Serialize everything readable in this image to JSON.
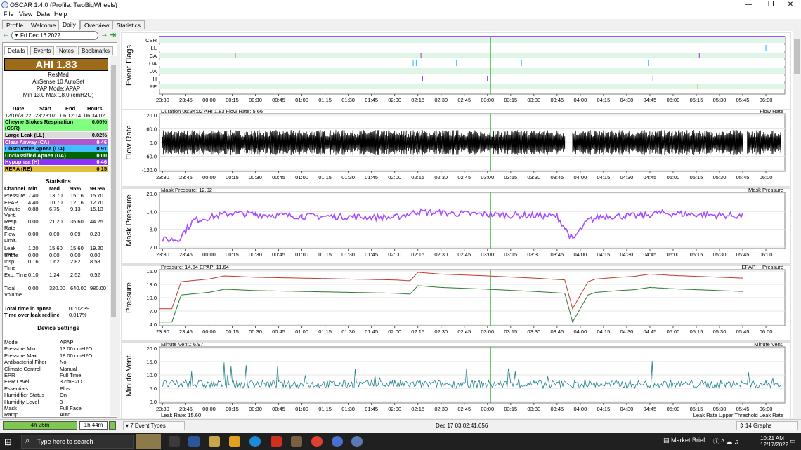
{
  "window": {
    "title": "OSCAR 1.4.0 (Profile: TwoBigWheels)",
    "controls": [
      "—",
      "❐",
      "✕"
    ]
  },
  "menu": [
    "File",
    "View",
    "Data",
    "Help"
  ],
  "tabs": [
    {
      "label": "Profile",
      "active": false
    },
    {
      "label": "Welcome",
      "active": false
    },
    {
      "label": "Daily",
      "active": true
    },
    {
      "label": "Overview",
      "active": false
    },
    {
      "label": "Statistics",
      "active": false
    }
  ],
  "date_nav": {
    "date": "Fri Dec 16 2022"
  },
  "subtabs": [
    {
      "label": "Details",
      "active": true
    },
    {
      "label": "Events",
      "active": false
    },
    {
      "label": "Notes",
      "active": false
    },
    {
      "label": "Bookmarks",
      "active": false
    }
  ],
  "summary": {
    "ahi": "AHI 1.83",
    "maker": "ResMed",
    "model": "AirSense 10 AutoSet",
    "mode": "PAP Mode: APAP",
    "range": "Min 13.0 Max 18.0 (cmH2O)"
  },
  "session": {
    "headers": [
      "Date",
      "Start",
      "End",
      "Hours"
    ],
    "values": [
      "12/16/2022",
      "23:28:07",
      "06:12:14",
      "06:34:02"
    ]
  },
  "events": [
    {
      "label": "Cheyne Stokes Respiration (CSR)",
      "value": "0.00%",
      "color": "#80ff80",
      "text": "#000"
    },
    {
      "label": "Large Leak (LL)",
      "value": "0.02%",
      "color": "#dcdcdc",
      "text": "#000"
    },
    {
      "label": "Clear Airway (CA)",
      "value": "0.46",
      "color": "#b254cd",
      "text": "#fff"
    },
    {
      "label": "Obstructive Apnea (OA)",
      "value": "0.91",
      "color": "#40c0ff",
      "text": "#000"
    },
    {
      "label": "Unclassified Apnea (UA)",
      "value": "0.00",
      "color": "#006400",
      "text": "#fff"
    },
    {
      "label": "Hypopnea (H)",
      "value": "0.46",
      "color": "#9030ff",
      "text": "#fff"
    },
    {
      "label": "RERA (RE)",
      "value": "0.15",
      "color": "#e0c040",
      "text": "#000"
    }
  ],
  "stats": {
    "title": "Statistics",
    "headers": [
      "Channel",
      "Min",
      "Med",
      "95%",
      "99.5%"
    ],
    "rows": [
      {
        "name": "Pressure",
        "vals": [
          "7.40",
          "13.70",
          "15.16",
          "15.70"
        ]
      },
      {
        "name": "EPAP",
        "vals": [
          "4.40",
          "10.70",
          "12.16",
          "12.70"
        ]
      },
      {
        "name": "Minute Vent.",
        "vals": [
          "0.88",
          "6.75",
          "9.13",
          "15.13"
        ]
      },
      {
        "name": "Resp. Rate",
        "vals": [
          "0.00",
          "21.20",
          "35.60",
          "44.25"
        ]
      },
      {
        "name": "Flow Limit.",
        "vals": [
          "0.00",
          "0.00",
          "0.09",
          "0.28"
        ]
      },
      {
        "name": "Leak Rate",
        "vals": [
          "1.20",
          "15.60",
          "15.60",
          "19.20"
        ]
      },
      {
        "name": "Snore",
        "vals": [
          "0.00",
          "0.00",
          "0.00",
          "0.00"
        ]
      },
      {
        "name": "Insp. Time",
        "vals": [
          "0.16",
          "1.62",
          "2.82",
          "8.58"
        ]
      },
      {
        "name": "Exp. Time",
        "vals": [
          "0.10",
          "1.24",
          "2.52",
          "6.52"
        ]
      },
      {
        "name": "Tidal Volume",
        "vals": [
          "0.00",
          "320.00",
          "640.00",
          "980.00"
        ]
      }
    ],
    "apnea_label": "Total time in apnea",
    "apnea_value": "00:02:39",
    "leak_label": "Time over leak redline",
    "leak_value": "0.017%"
  },
  "device": {
    "title": "Device Settings",
    "rows": [
      {
        "k": "Mode",
        "v": "APAP"
      },
      {
        "k": "Pressure Min",
        "v": "13.00 cmH2O"
      },
      {
        "k": "Pressure Max",
        "v": "18.00 cmH2O"
      },
      {
        "k": "Antibacterial Filter",
        "v": "No"
      },
      {
        "k": "Climate Control",
        "v": "Manual"
      },
      {
        "k": "EPR",
        "v": "Full Time"
      },
      {
        "k": "EPR Level",
        "v": "3 cmH2O"
      },
      {
        "k": "Essentials",
        "v": "Plus"
      },
      {
        "k": "Humidifier Status",
        "v": "On"
      },
      {
        "k": "Humidity Level",
        "v": "3"
      },
      {
        "k": "Mask",
        "v": "Full Face"
      },
      {
        "k": "Ramp",
        "v": "Auto"
      }
    ]
  },
  "time_ticks": [
    "23:30",
    "23:45",
    "00:00",
    "00:15",
    "00:30",
    "00:45",
    "01:00",
    "01:15",
    "01:30",
    "01:45",
    "02:00",
    "02:15",
    "02:30",
    "02:45",
    "03:00",
    "03:15",
    "03:30",
    "03:45",
    "04:00",
    "04:15",
    "04:30",
    "04:45",
    "05:00",
    "05:15",
    "05:30",
    "05:45",
    "06:00"
  ],
  "graphs": [
    {
      "key": "flags",
      "ylabel": "Event Flags",
      "rows": [
        "CSR",
        "LL",
        "CA",
        "OA",
        "UA",
        "H",
        "RE"
      ]
    },
    {
      "key": "flow",
      "ylabel": "Flow Rate",
      "header": "Duration 06:34:02 AHI 1.83 Flow Rate: 5.66",
      "legend": "Flow Rate",
      "yticks": [
        "120.0",
        "60.0",
        "0.0",
        "-60.0",
        "-120.0"
      ],
      "color": "#000000"
    },
    {
      "key": "mask",
      "ylabel": "Mask Pressure",
      "header": "Mask Pressure: 12.02",
      "legend": "Mask Pressure",
      "yticks": [
        "20.0",
        "14.0",
        "8.0",
        "2.0"
      ],
      "color": "#a64dff"
    },
    {
      "key": "pressure",
      "ylabel": "Pressure",
      "header": "Pressure: 14.64 EPAP: 11.64",
      "legend_epap": "EPAP",
      "legend_pressure": "Pressure",
      "yticks": [
        "16.0",
        "13.0",
        "10.0",
        "7.0",
        "4.0"
      ],
      "color_epap": "#2a7a2a",
      "color_pressure": "#c0392b"
    },
    {
      "key": "minvent",
      "ylabel": "Minute Vent.",
      "header": "Minute Vent.: 6.97",
      "legend": "Minute Vent.",
      "yticks": [
        "20.0",
        "15.0",
        "10.0",
        "5.0",
        "0.0"
      ],
      "color": "#1f7f8a"
    },
    {
      "key": "leak",
      "header": "Leak Rate: 15.60",
      "legend": "Leak Rate Upper Threshold Leak Rate"
    }
  ],
  "chart_data": [
    {
      "type": "line",
      "title": "",
      "ylabel": "Pressure",
      "ylim": [
        4,
        16
      ],
      "series": [
        {
          "name": "Pressure",
          "x": [
            "23:28",
            "23:36",
            "23:42",
            "00:00",
            "00:10",
            "00:30",
            "01:00",
            "01:30",
            "02:00",
            "02:10",
            "02:15",
            "02:30",
            "03:00",
            "03:30",
            "03:50",
            "03:55",
            "04:05",
            "04:10",
            "04:25",
            "04:35",
            "04:45",
            "05:00",
            "05:15",
            "05:30",
            "05:45"
          ],
          "values": [
            7.5,
            7.5,
            13.6,
            14.2,
            14.9,
            14.6,
            14.4,
            14.2,
            14.0,
            13.8,
            15.7,
            15.3,
            14.9,
            14.4,
            14.0,
            7.5,
            13.6,
            14.2,
            14.6,
            14.8,
            15.3,
            15.0,
            14.8,
            14.6,
            14.4
          ]
        },
        {
          "name": "EPAP",
          "x": [
            "23:28",
            "23:36",
            "23:42",
            "00:00",
            "00:10",
            "00:30",
            "01:00",
            "01:30",
            "02:00",
            "02:10",
            "02:15",
            "02:30",
            "03:00",
            "03:30",
            "03:50",
            "03:55",
            "04:05",
            "04:10",
            "04:25",
            "04:35",
            "04:45",
            "05:00",
            "05:15",
            "05:30",
            "05:45"
          ],
          "values": [
            4.5,
            4.5,
            10.6,
            11.2,
            11.9,
            11.6,
            11.4,
            11.2,
            11.0,
            10.8,
            12.7,
            12.3,
            11.9,
            11.4,
            11.0,
            4.5,
            10.6,
            11.2,
            11.6,
            11.8,
            12.3,
            12.0,
            11.8,
            11.6,
            11.4
          ]
        }
      ]
    },
    {
      "type": "line",
      "title": "",
      "ylabel": "Mask Pressure",
      "ylim": [
        2,
        20
      ],
      "series": [
        {
          "name": "Mask Pressure",
          "x": [
            "23:30",
            "23:40",
            "23:50",
            "00:15",
            "00:30",
            "01:00",
            "02:00",
            "02:15",
            "02:30",
            "03:00",
            "03:45",
            "03:55",
            "04:05",
            "04:15",
            "04:40",
            "04:50",
            "05:45"
          ],
          "values": [
            4.5,
            4.5,
            11.0,
            13.5,
            13.0,
            12.5,
            12.0,
            14.0,
            13.5,
            13.0,
            12.5,
            4.5,
            11.0,
            12.5,
            12.5,
            13.5,
            12.5
          ]
        }
      ]
    }
  ]
}
